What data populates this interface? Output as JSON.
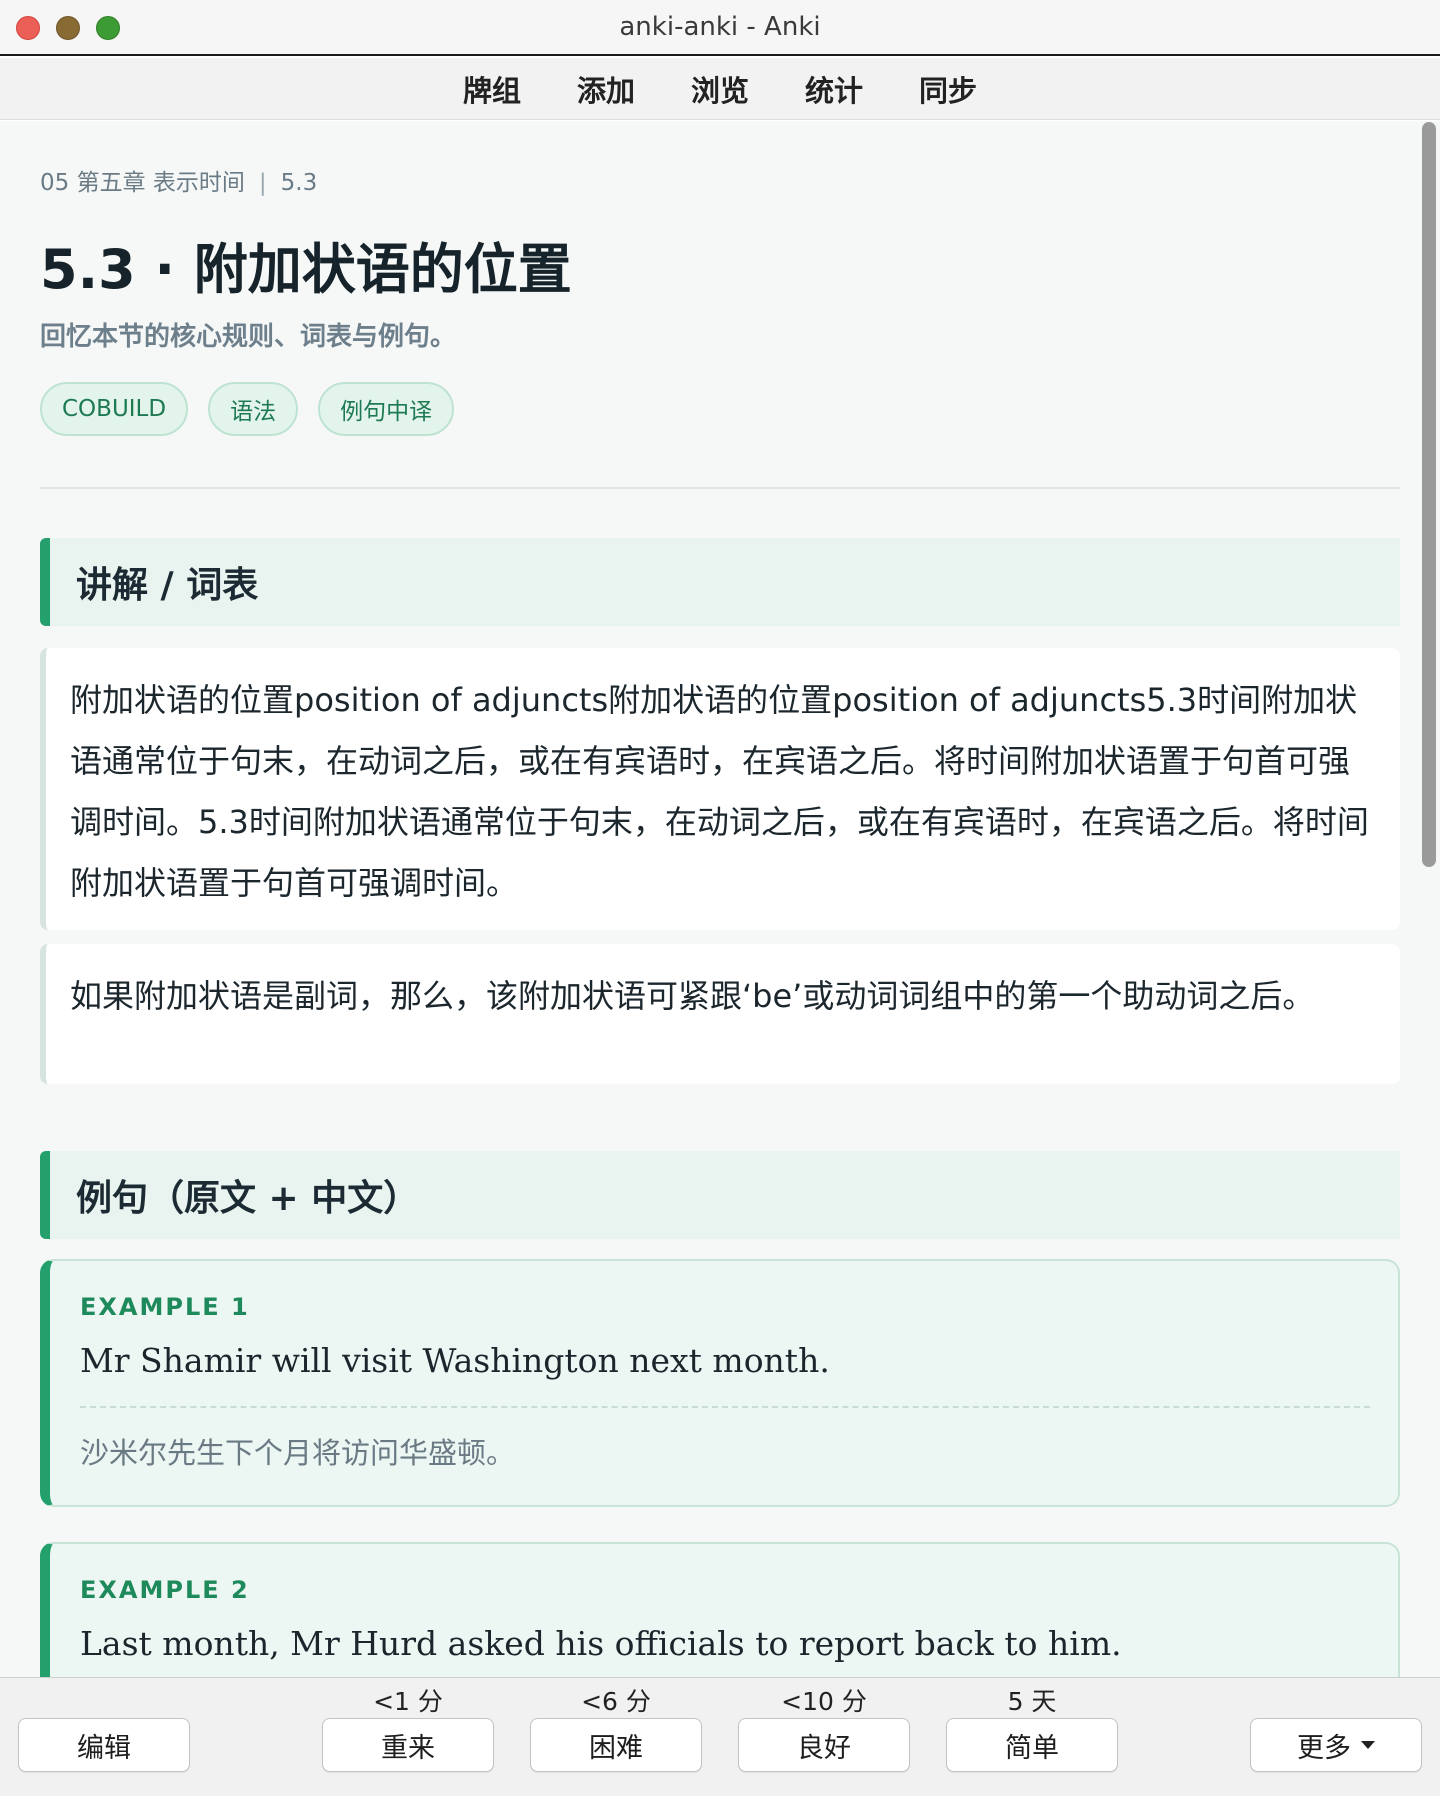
{
  "window": {
    "title": "anki-anki - Anki"
  },
  "toolbar": {
    "items": [
      "牌组",
      "添加",
      "浏览",
      "统计",
      "同步"
    ]
  },
  "card": {
    "breadcrumb": {
      "chapter": "05 第五章 表示时间",
      "separator": "|",
      "section": "5.3"
    },
    "title": "5.3 · 附加状语的位置",
    "subtitle": "回忆本节的核心规则、词表与例句。",
    "tags": [
      "COBUILD",
      "语法",
      "例句中译"
    ],
    "sections": {
      "explanation": {
        "header": "讲解 / 词表",
        "paragraphs": [
          "附加状语的位置position of adjuncts附加状语的位置position of adjuncts5.3时间附加状语通常位于句末，在动词之后，或在有宾语时，在宾语之后。将时间附加状语置于句首可强调时间。5.3时间附加状语通常位于句末，在动词之后，或在有宾语时，在宾语之后。将时间附加状语置于句首可强调时间。",
          "如果附加状语是副词，那么，该附加状语可紧跟‘be’或动词词组中的第一个助动词之后。"
        ]
      },
      "examples": {
        "header": "例句（原文 + 中文）",
        "items": [
          {
            "label": "EXAMPLE 1",
            "en": "Mr Shamir will visit Washington next month.",
            "zh": "沙米尔先生下个月将访问华盛顿。"
          },
          {
            "label": "EXAMPLE 2",
            "en": "Last month, Mr Hurd asked his officials to report back to him.",
            "zh": ""
          }
        ]
      }
    }
  },
  "answer_bar": {
    "edit": "编辑",
    "buttons": [
      {
        "interval": "<1 分",
        "label": "重来"
      },
      {
        "interval": "<6 分",
        "label": "困难"
      },
      {
        "interval": "<10 分",
        "label": "良好"
      },
      {
        "interval": "5 天",
        "label": "简单"
      }
    ],
    "more": "更多"
  }
}
